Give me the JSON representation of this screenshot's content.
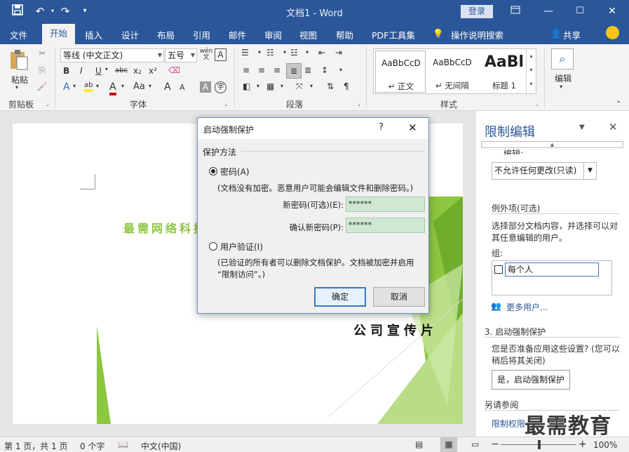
{
  "title_bar": {
    "doc_title": "文档1 - Word",
    "login": "登录",
    "qat": {
      "save": "save-icon",
      "undo": "undo-icon",
      "redo": "redo-icon"
    }
  },
  "menu": {
    "items": [
      "文件",
      "开始",
      "插入",
      "设计",
      "布局",
      "引用",
      "邮件",
      "审阅",
      "视图",
      "帮助",
      "PDF工具集",
      "操作说明搜索"
    ],
    "active": "开始",
    "share": "共享"
  },
  "ribbon": {
    "clipboard": {
      "paste": "粘贴",
      "label": "剪贴板"
    },
    "font": {
      "name": "等线 (中文正文)",
      "size": "五号",
      "label": "字体",
      "wen": "wén",
      "a": "A",
      "bold": "B",
      "italic": "I",
      "underline": "U",
      "strike": "abc",
      "sub": "x₂",
      "sup": "x²",
      "fonta": "A",
      "ab": "ab",
      "aa": "Aa",
      "grow": "A",
      "shrink": "A",
      "char": "A",
      "enc": "字"
    },
    "paragraph": {
      "label": "段落"
    },
    "styles": {
      "label": "样式",
      "items": [
        {
          "preview": "AaBbCcD",
          "name": "↵ 正文"
        },
        {
          "preview": "AaBbCcD",
          "name": "↵ 无间隔"
        },
        {
          "preview": "AaBl",
          "name": "标题 1"
        }
      ]
    },
    "editing": {
      "label": "编辑"
    }
  },
  "document": {
    "company": "最需网络科技",
    "slogan": "公司宣传片"
  },
  "pane": {
    "title": "限制编辑",
    "edit_label": "编辑:",
    "edit_select": "不允许任何更改(只读)",
    "exceptions_header": "例外项(可选)",
    "exceptions_text": "选择部分文档内容，并选择可以对其任意编辑的用户。",
    "group_label": "组:",
    "everyone": "每个人",
    "more_users": "更多用户...",
    "step3_header": "3. 启动强制保护",
    "step3_text": "您是否准备应用这些设置? (您可以稍后将其关闭)",
    "start_button": "是，启动强制保护",
    "also_see": "另请参阅",
    "restrict_link": "限制权限",
    "watermark": "最需教育"
  },
  "dialog": {
    "title": "启动强制保护",
    "help": "?",
    "close": "✕",
    "method_label": "保护方法",
    "password_radio": "密码(A)",
    "password_desc": "(文档没有加密。恶意用户可能会编辑文件和删除密码。)",
    "new_pwd_label": "新密码(可选)(E):",
    "new_pwd_value": "******",
    "confirm_pwd_label": "确认新密码(P):",
    "confirm_pwd_value": "******",
    "user_auth_radio": "用户验证(I)",
    "user_auth_desc1": "(已验证的所有者可以删除文档保护。文档被加密并启用",
    "user_auth_desc2": "“限制访问”。)",
    "ok": "确定",
    "cancel": "取消",
    "selected_method": "password"
  },
  "status": {
    "page": "第 1 页，共 1 页",
    "words": "0 个字",
    "lang": "中文(中国)",
    "zoom": "100%",
    "zoom_minus": "−",
    "zoom_plus": "+"
  },
  "colors": {
    "brand": "#2b579a",
    "pwd_field": "#cfe8d2",
    "accent_green": "#8dc63f"
  }
}
